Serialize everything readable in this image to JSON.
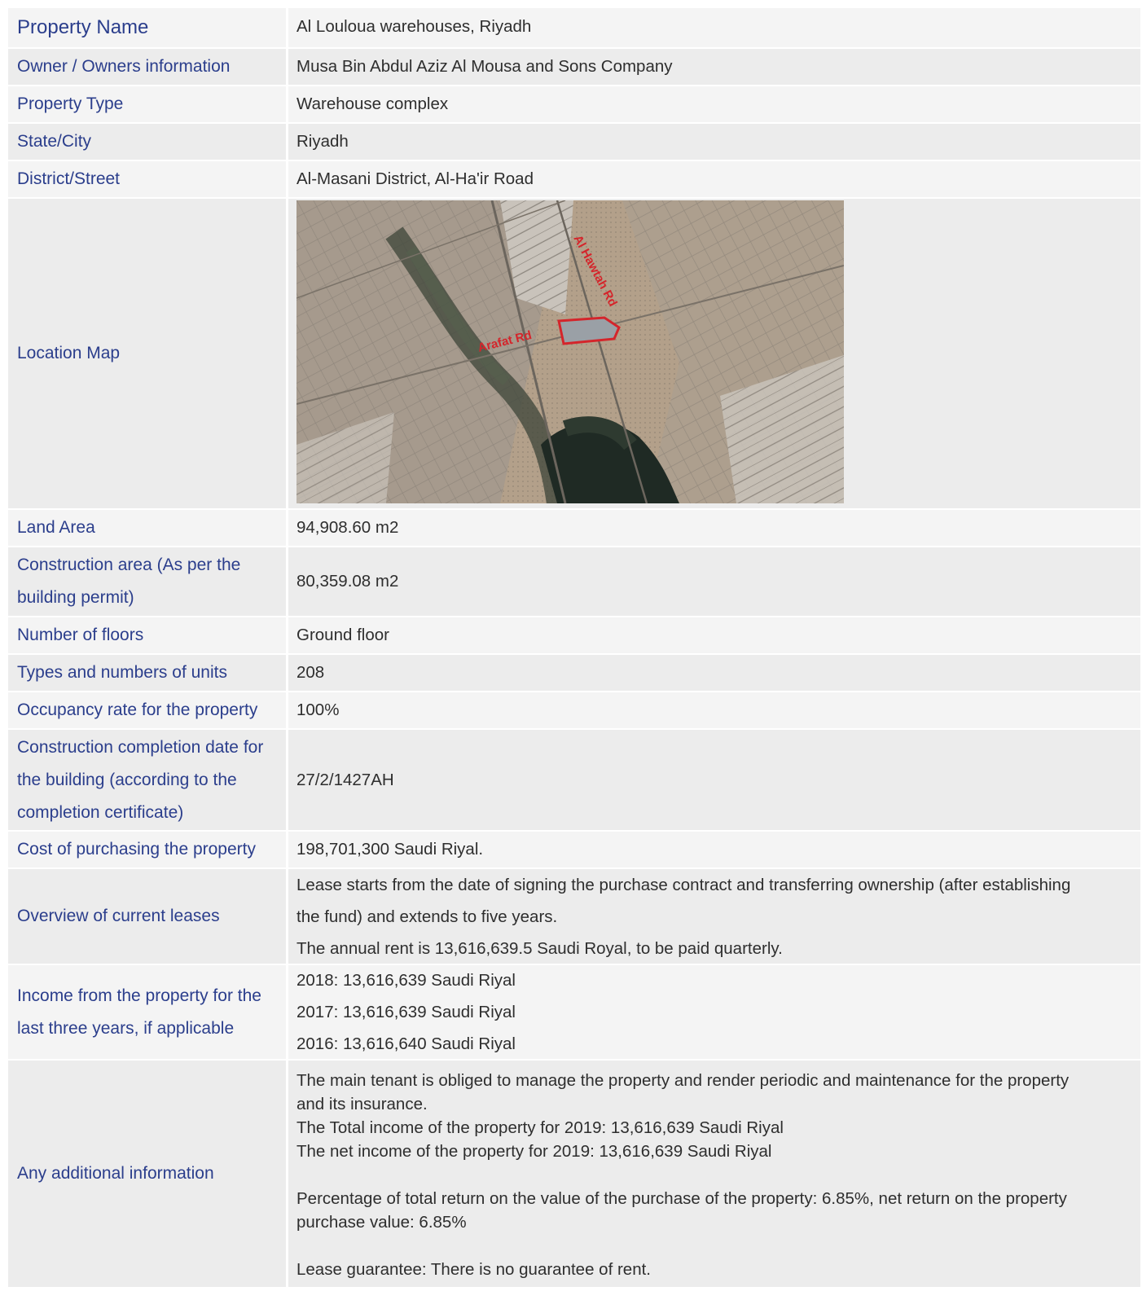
{
  "rows": [
    {
      "label": "Property Name",
      "value": "Al Louloua warehouses, Riyadh"
    },
    {
      "label": "Owner / Owners information",
      "value": "Musa Bin Abdul Aziz Al Mousa and Sons Company"
    },
    {
      "label": "Property Type",
      "value": "Warehouse complex"
    },
    {
      "label": "State/City",
      "value": "Riyadh"
    },
    {
      "label": "District/Street",
      "value": "Al-Masani District, Al-Ha'ir Road"
    },
    {
      "label": "Location Map"
    },
    {
      "label": "Land Area",
      "value": "94,908.60 m2"
    },
    {
      "label": "Construction area (As per the building permit)",
      "value": "80,359.08 m2"
    },
    {
      "label": "Number of floors",
      "value": "Ground floor"
    },
    {
      "label": "Types and numbers of units",
      "value": "208"
    },
    {
      "label": "Occupancy rate for the property",
      "value": "100%"
    },
    {
      "label": "Construction completion date for the building (according to the completion certificate)",
      "value": "27/2/1427AH"
    },
    {
      "label": "Cost of purchasing the property",
      "value": "198,701,300 Saudi Riyal."
    },
    {
      "label": "Overview of current leases",
      "lines": [
        "Lease starts from the date of signing the purchase contract and transferring ownership (after establishing",
        "the fund) and extends to five years.",
        "The annual rent is 13,616,639.5 Saudi Royal, to be paid quarterly."
      ]
    },
    {
      "label": "Income from the property for the last three years, if applicable",
      "lines": [
        "2018: 13,616,639 Saudi Riyal",
        "2017: 13,616,639 Saudi Riyal",
        "2016: 13,616,640 Saudi Riyal"
      ]
    },
    {
      "label": "Any additional information",
      "lines": [
        "The main tenant is obliged to manage the property and render periodic and maintenance for the property",
        "and its insurance.",
        "The Total income of the property for 2019: 13,616,639 Saudi Riyal",
        "The net income of the property for 2019: 13,616,639 Saudi Riyal",
        "",
        "Percentage of total return on the value of the purchase of the property: 6.85%, net return on the property",
        "purchase value: 6.85%",
        "",
        "Lease guarantee: There is no guarantee of rent."
      ]
    }
  ],
  "map": {
    "road_label_1": "Al Hawtah Rd",
    "road_label_2": "Arafat Rd",
    "colors": {
      "sand": "#b8a48a",
      "urban": "#a89b8c",
      "vegetation": "#2e3a30",
      "outline": "#d4252b"
    }
  },
  "colors": {
    "label_text": "#2b3e8c",
    "value_text": "#2e2e2e",
    "row_light": "#f4f4f4",
    "row_dark": "#ececec"
  }
}
